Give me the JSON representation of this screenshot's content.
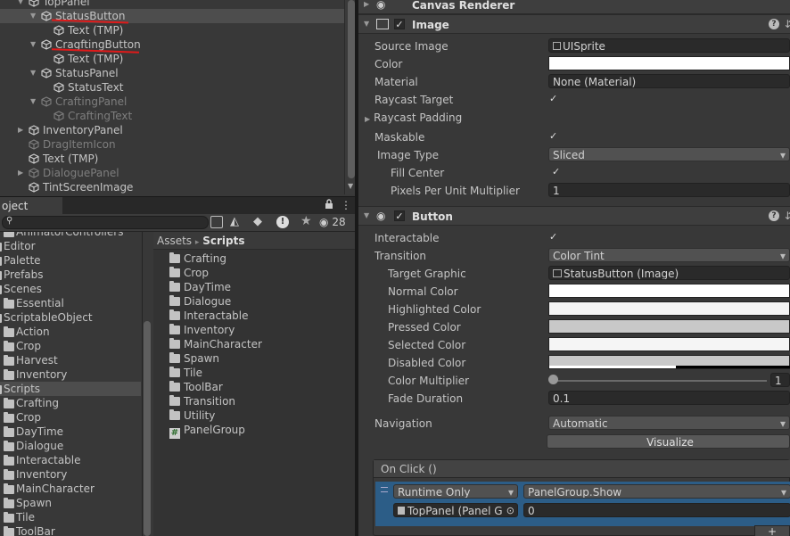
{
  "hierarchy": {
    "items": [
      {
        "label": "TopPanel",
        "indent": 1,
        "fold": "open",
        "dim": false
      },
      {
        "label": "StatusButton",
        "indent": 2,
        "fold": "open",
        "dim": false,
        "selected": true
      },
      {
        "label": "Text (TMP)",
        "indent": 3,
        "fold": "none",
        "dim": false
      },
      {
        "label": "CragftingButton",
        "indent": 2,
        "fold": "open",
        "dim": false
      },
      {
        "label": "Text (TMP)",
        "indent": 3,
        "fold": "none",
        "dim": false
      },
      {
        "label": "StatusPanel",
        "indent": 2,
        "fold": "open",
        "dim": false
      },
      {
        "label": "StatusText",
        "indent": 3,
        "fold": "none",
        "dim": false
      },
      {
        "label": "CraftingPanel",
        "indent": 2,
        "fold": "open",
        "dim": true
      },
      {
        "label": "CraftingText",
        "indent": 3,
        "fold": "none",
        "dim": true
      },
      {
        "label": "InventoryPanel",
        "indent": 1,
        "fold": "closed",
        "dim": false
      },
      {
        "label": "DragItemIcon",
        "indent": 1,
        "fold": "none",
        "dim": true
      },
      {
        "label": "Text (TMP)",
        "indent": 1,
        "fold": "none",
        "dim": false
      },
      {
        "label": "DialoguePanel",
        "indent": 1,
        "fold": "closed",
        "dim": true
      },
      {
        "label": "TintScreenImage",
        "indent": 1,
        "fold": "none",
        "dim": false
      }
    ]
  },
  "project": {
    "tab_label": "oject",
    "search_placeholder": "",
    "count_badge": "28",
    "left_tree": [
      {
        "label": "AnimatorControllers",
        "indent": 1
      },
      {
        "label": "Editor",
        "indent": 0
      },
      {
        "label": "Palette",
        "indent": 0
      },
      {
        "label": "Prefabs",
        "indent": 0
      },
      {
        "label": "Scenes",
        "indent": 0,
        "fold": true
      },
      {
        "label": "Essential",
        "indent": 1
      },
      {
        "label": "ScriptableObject",
        "indent": 0,
        "fold": true
      },
      {
        "label": "Action",
        "indent": 1
      },
      {
        "label": "Crop",
        "indent": 1
      },
      {
        "label": "Harvest",
        "indent": 1
      },
      {
        "label": "Inventory",
        "indent": 1
      },
      {
        "label": "Scripts",
        "indent": 0,
        "fold": true,
        "selected": true
      },
      {
        "label": "Crafting",
        "indent": 1
      },
      {
        "label": "Crop",
        "indent": 1
      },
      {
        "label": "DayTime",
        "indent": 1
      },
      {
        "label": "Dialogue",
        "indent": 1
      },
      {
        "label": "Interactable",
        "indent": 1
      },
      {
        "label": "Inventory",
        "indent": 1
      },
      {
        "label": "MainCharacter",
        "indent": 1
      },
      {
        "label": "Spawn",
        "indent": 1
      },
      {
        "label": "Tile",
        "indent": 1
      },
      {
        "label": "ToolBar",
        "indent": 1
      }
    ],
    "breadcrumb": {
      "root": "Assets",
      "sep": "▸",
      "current": "Scripts"
    },
    "folder_items": [
      "Crafting",
      "Crop",
      "DayTime",
      "Dialogue",
      "Interactable",
      "Inventory",
      "MainCharacter",
      "Spawn",
      "Tile",
      "ToolBar",
      "Transition",
      "Utility"
    ],
    "script_item": "PanelGroup"
  },
  "inspector": {
    "canvas_renderer": "Canvas Renderer",
    "image": {
      "title": "Image",
      "source_image_label": "Source Image",
      "source_image_value": "UISprite",
      "color_label": "Color",
      "material_label": "Material",
      "material_value": "None (Material)",
      "raycast_target_label": "Raycast Target",
      "raycast_padding_label": "Raycast Padding",
      "maskable_label": "Maskable",
      "image_type_label": "Image Type",
      "image_type_value": "Sliced",
      "fill_center_label": "Fill Center",
      "ppu_label": "Pixels Per Unit Multiplier",
      "ppu_value": "1"
    },
    "button": {
      "title": "Button",
      "interactable_label": "Interactable",
      "transition_label": "Transition",
      "transition_value": "Color Tint",
      "target_graphic_label": "Target Graphic",
      "target_graphic_value": "StatusButton (Image)",
      "normal_color_label": "Normal Color",
      "highlighted_color_label": "Highlighted Color",
      "pressed_color_label": "Pressed Color",
      "selected_color_label": "Selected Color",
      "disabled_color_label": "Disabled Color",
      "color_multiplier_label": "Color Multiplier",
      "color_multiplier_value": "1",
      "color_multiplier_level": 0.0,
      "fade_duration_label": "Fade Duration",
      "fade_duration_value": "0.1",
      "navigation_label": "Navigation",
      "navigation_value": "Automatic",
      "visualize_label": "Visualize",
      "on_click_label": "On Click ()",
      "runtime_value": "Runtime Only",
      "function_value": "PanelGroup.Show",
      "object_value": "TopPanel (Panel G",
      "arg_value": "0",
      "add_label": "+"
    }
  },
  "colors": {
    "panel_bg": "#383838",
    "field_bg": "#2a2a2a",
    "selection": "#4d4d4d",
    "accent_blue": "#2c5d87",
    "annotation_red": "#e01a1a"
  }
}
